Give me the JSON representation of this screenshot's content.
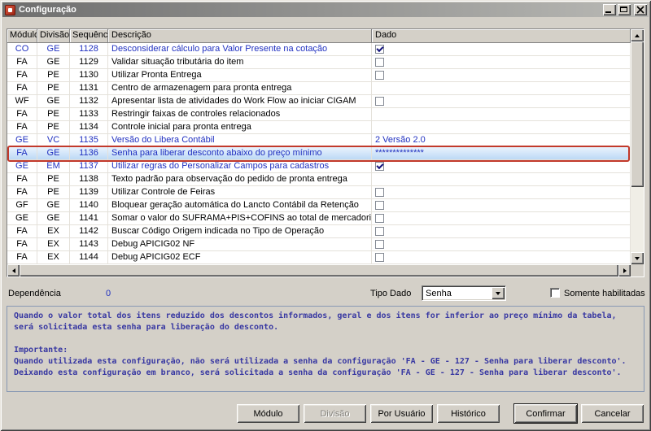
{
  "window": {
    "title": "Configuração"
  },
  "grid": {
    "columns": [
      "Módulo",
      "Divisão",
      "Sequência",
      "Descrição",
      "Dado"
    ],
    "rows": [
      {
        "modulo": "CO",
        "divisao": "GE",
        "seq": "1128",
        "desc": "Desconsiderar cálculo para Valor Presente na cotação",
        "dado_type": "check",
        "blue": true,
        "selected": false
      },
      {
        "modulo": "FA",
        "divisao": "GE",
        "seq": "1129",
        "desc": "Validar situação tributária do item",
        "dado_type": "uncheck",
        "blue": false,
        "selected": false
      },
      {
        "modulo": "FA",
        "divisao": "PE",
        "seq": "1130",
        "desc": "Utilizar Pronta Entrega",
        "dado_type": "uncheck",
        "blue": false,
        "selected": false
      },
      {
        "modulo": "FA",
        "divisao": "PE",
        "seq": "1131",
        "desc": "Centro de armazenagem para pronta entrega",
        "dado_type": "none",
        "blue": false,
        "selected": false
      },
      {
        "modulo": "WF",
        "divisao": "GE",
        "seq": "1132",
        "desc": "Apresentar lista de atividades do Work Flow ao iniciar CIGAM",
        "dado_type": "uncheck",
        "blue": false,
        "selected": false
      },
      {
        "modulo": "FA",
        "divisao": "PE",
        "seq": "1133",
        "desc": "Restringir faixas de controles relacionados",
        "dado_type": "none",
        "blue": false,
        "selected": false
      },
      {
        "modulo": "FA",
        "divisao": "PE",
        "seq": "1134",
        "desc": "Controle inicial para pronta entrega",
        "dado_type": "none",
        "blue": false,
        "selected": false
      },
      {
        "modulo": "GE",
        "divisao": "VC",
        "seq": "1135",
        "desc": "Versão do Libera Contábil",
        "dado_type": "text",
        "dado_text": "2 Versão 2.0",
        "blue": true,
        "selected": false
      },
      {
        "modulo": "FA",
        "divisao": "GE",
        "seq": "1136",
        "desc": "Senha para liberar desconto abaixo do preço mínimo",
        "dado_type": "text",
        "dado_text": "**************",
        "blue": true,
        "selected": true
      },
      {
        "modulo": "GE",
        "divisao": "EM",
        "seq": "1137",
        "desc": "Utilizar regras do Personalizar Campos para cadastros",
        "dado_type": "check",
        "blue": true,
        "selected": false
      },
      {
        "modulo": "FA",
        "divisao": "PE",
        "seq": "1138",
        "desc": "Texto padrão para  observação do pedido de pronta entrega",
        "dado_type": "none",
        "blue": false,
        "selected": false
      },
      {
        "modulo": "FA",
        "divisao": "PE",
        "seq": "1139",
        "desc": "Utilizar Controle de Feiras",
        "dado_type": "uncheck",
        "blue": false,
        "selected": false
      },
      {
        "modulo": "GF",
        "divisao": "GE",
        "seq": "1140",
        "desc": "Bloquear geração automática do Lancto Contábil da Retenção",
        "dado_type": "uncheck",
        "blue": false,
        "selected": false
      },
      {
        "modulo": "GE",
        "divisao": "GE",
        "seq": "1141",
        "desc": "Somar o valor do SUFRAMA+PIS+COFINS ao total de mercadorias",
        "dado_type": "uncheck",
        "blue": false,
        "selected": false
      },
      {
        "modulo": "FA",
        "divisao": "EX",
        "seq": "1142",
        "desc": "Buscar Código Origem indicada no Tipo de Operação",
        "dado_type": "uncheck",
        "blue": false,
        "selected": false
      },
      {
        "modulo": "FA",
        "divisao": "EX",
        "seq": "1143",
        "desc": "Debug APICIG02 NF",
        "dado_type": "uncheck",
        "blue": false,
        "selected": false
      },
      {
        "modulo": "FA",
        "divisao": "EX",
        "seq": "1144",
        "desc": "Debug APICIG02 ECF",
        "dado_type": "uncheck",
        "blue": false,
        "selected": false
      }
    ]
  },
  "footer": {
    "dependencia_label": "Dependência",
    "dependencia_value": "0",
    "tipo_dado_label": "Tipo Dado",
    "tipo_dado_value": "Senha",
    "somente_habilitadas_label": "Somente habilitadas"
  },
  "help": {
    "text": "Quando o valor total dos itens reduzido dos descontos informados, geral e dos itens for inferior ao preço mínimo da tabela,\nserá solicitada esta senha para liberação do desconto.\n\nImportante:\nQuando utilizada esta configuração, não será utilizada a senha da configuração 'FA - GE - 127 - Senha para liberar desconto'.\nDeixando esta configuração em branco, será solicitada a senha da configuração 'FA - GE - 127 - Senha para liberar desconto'."
  },
  "buttons": {
    "modulo": "Módulo",
    "divisao": "Divisão",
    "por_usuario": "Por Usuário",
    "historico": "Histórico",
    "confirmar": "Confirmar",
    "cancelar": "Cancelar"
  }
}
